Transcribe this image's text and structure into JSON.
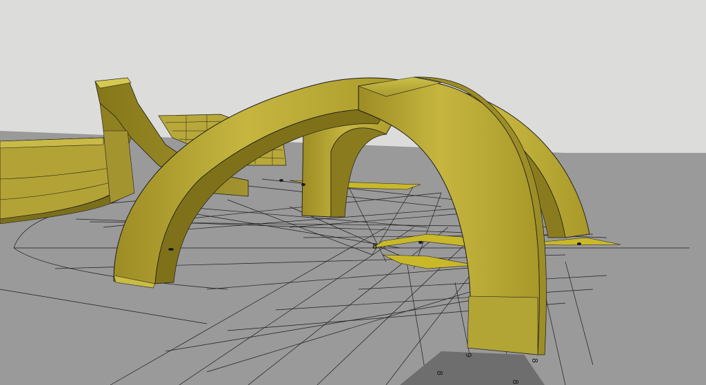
{
  "scene": {
    "sky_color": "#dcdcda",
    "ground_color": "#9a9a9a",
    "arch_color": "#c2b23c",
    "arch_dark": "#6f6418",
    "arch_light": "#d8cc5a",
    "line_color": "#1a1a1a",
    "highlight_color": "#c8b82a",
    "markers": [
      {
        "label": "8"
      },
      {
        "label": "9"
      },
      {
        "label": "8"
      },
      {
        "label": "8"
      },
      {
        "label": "8"
      }
    ]
  }
}
